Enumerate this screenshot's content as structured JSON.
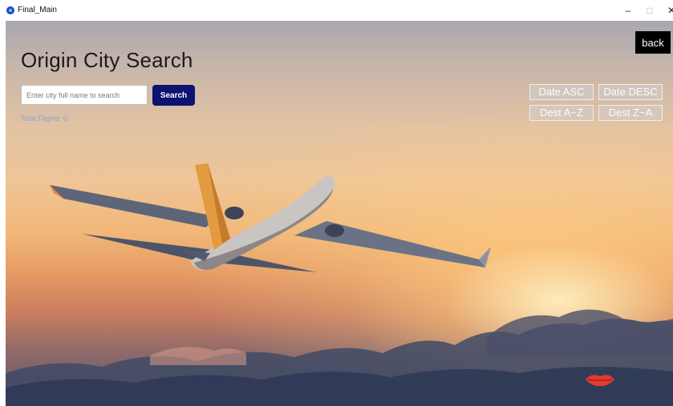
{
  "window": {
    "title": "Final_Main",
    "controls": {
      "minimize": "–",
      "maximize": "□",
      "close": "✕"
    }
  },
  "page": {
    "heading": "Origin City Search",
    "search": {
      "placeholder": "Enter city full name to search",
      "value": "",
      "button_label": "Search"
    },
    "total_flights": "Total Flights: 0",
    "back_label": "back",
    "sort_buttons": {
      "date_asc": "Date ASC",
      "date_desc": "Date DESC",
      "dest_az": "Dest A~Z",
      "dest_za": "Dest Z~A"
    }
  },
  "colors": {
    "search_button": "#0b1270",
    "back_button": "#000000",
    "total_flights_text": "#8aa0d6"
  },
  "icons": [
    "app-icon",
    "airplane-image",
    "lips-icon"
  ]
}
